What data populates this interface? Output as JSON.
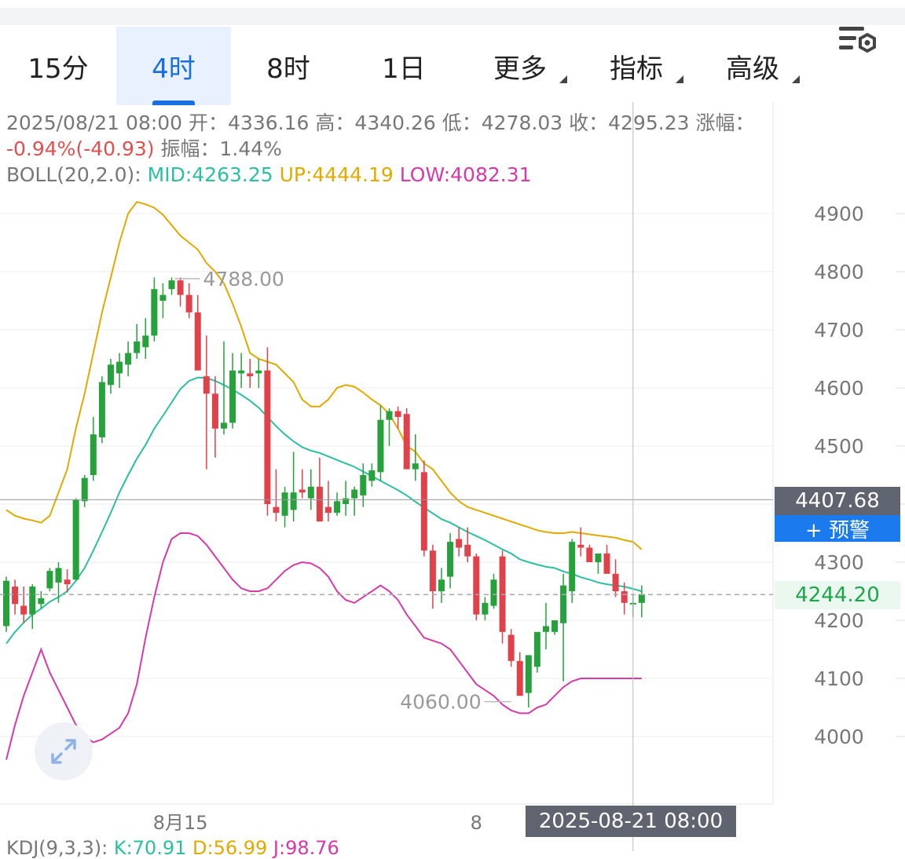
{
  "tabs": [
    {
      "label": "15分",
      "dropdown": false
    },
    {
      "label": "4时",
      "dropdown": false,
      "active": true
    },
    {
      "label": "8时",
      "dropdown": false
    },
    {
      "label": "1日",
      "dropdown": false
    },
    {
      "label": "更多",
      "dropdown": true
    },
    {
      "label": "指标",
      "dropdown": true
    },
    {
      "label": "高级",
      "dropdown": true
    }
  ],
  "info": {
    "datetime": "2025/08/21 08:00",
    "open_label": "开：",
    "open": "4336.16",
    "high_label": "高：",
    "high": "4340.26",
    "low_label": "低：",
    "low": "4278.03",
    "close_label": "收：",
    "close": "4295.23",
    "change_label": "涨幅：",
    "change": "-0.94%(-40.93)",
    "amplitude_label": "振幅：",
    "amplitude": "1.44%",
    "boll_label": "BOLL(20,2.0):",
    "boll_mid": "MID:4263.25",
    "boll_up": "UP:4444.19",
    "boll_low": "LOW:4082.31"
  },
  "crosshair_price": "4407.68",
  "alert_button": "+ 预警",
  "last_price": "4244.20",
  "crosshair_time": "2025-08-21 08:00",
  "kdj": {
    "label": "KDJ(9,3,3):",
    "k": "K:70.91",
    "d": "D:56.99",
    "j": "J:98.76"
  },
  "colors": {
    "up": "#26a13b",
    "down": "#e0424b",
    "mid": "#2bbfa0",
    "upper": "#e0aa00",
    "lower": "#d63aa8",
    "accent": "#1a6fe0"
  },
  "chart_data": {
    "type": "candlestick",
    "ylim": [
      3940,
      4960
    ],
    "y_ticks": [
      4000,
      4100,
      4200,
      4300,
      4400,
      4500,
      4600,
      4700,
      4800,
      4900
    ],
    "y_tick_labels": [
      "4000",
      "4100",
      "4200",
      "4300",
      "",
      "4500",
      "4600",
      "4700",
      "4800",
      "4900"
    ],
    "x_labels": [
      {
        "index": 20,
        "label": "8月15"
      },
      {
        "index": 54,
        "label": "8"
      }
    ],
    "annotations": [
      {
        "index": 19,
        "value": 4788.0,
        "label": "4788.00"
      },
      {
        "index": 58,
        "value": 4060.0,
        "label": "4060.00"
      }
    ],
    "candles": [
      [
        4190,
        4275,
        4180,
        4268
      ],
      [
        4258,
        4270,
        4210,
        4228
      ],
      [
        4225,
        4258,
        4195,
        4210
      ],
      [
        4210,
        4262,
        4185,
        4258
      ],
      [
        4228,
        4250,
        4220,
        4238
      ],
      [
        4255,
        4290,
        4250,
        4285
      ],
      [
        4265,
        4300,
        4230,
        4290
      ],
      [
        4270,
        4288,
        4248,
        4262
      ],
      [
        4270,
        4410,
        4268,
        4408
      ],
      [
        4405,
        4450,
        4395,
        4445
      ],
      [
        4450,
        4550,
        4440,
        4520
      ],
      [
        4515,
        4620,
        4505,
        4610
      ],
      [
        4605,
        4650,
        4590,
        4640
      ],
      [
        4625,
        4660,
        4600,
        4645
      ],
      [
        4640,
        4680,
        4620,
        4660
      ],
      [
        4660,
        4710,
        4650,
        4680
      ],
      [
        4670,
        4720,
        4650,
        4690
      ],
      [
        4690,
        4790,
        4680,
        4770
      ],
      [
        4750,
        4780,
        4720,
        4760
      ],
      [
        4770,
        4790,
        4760,
        4785
      ],
      [
        4785,
        4790,
        4740,
        4760
      ],
      [
        4760,
        4780,
        4720,
        4730
      ],
      [
        4730,
        4760,
        4640,
        4630
      ],
      [
        4620,
        4690,
        4460,
        4590
      ],
      [
        4590,
        4620,
        4480,
        4530
      ],
      [
        4530,
        4680,
        4520,
        4540
      ],
      [
        4540,
        4660,
        4530,
        4630
      ],
      [
        4625,
        4660,
        4600,
        4630
      ],
      [
        4625,
        4650,
        4600,
        4620
      ],
      [
        4625,
        4650,
        4600,
        4630
      ],
      [
        4630,
        4670,
        4380,
        4400
      ],
      [
        4395,
        4460,
        4370,
        4385
      ],
      [
        4380,
        4430,
        4360,
        4420
      ],
      [
        4390,
        4490,
        4370,
        4420
      ],
      [
        4425,
        4460,
        4410,
        4420
      ],
      [
        4410,
        4460,
        4390,
        4430
      ],
      [
        4430,
        4480,
        4370,
        4370
      ],
      [
        4395,
        4440,
        4370,
        4385
      ],
      [
        4385,
        4420,
        4380,
        4405
      ],
      [
        4400,
        4440,
        4380,
        4410
      ],
      [
        4410,
        4430,
        4380,
        4425
      ],
      [
        4415,
        4470,
        4395,
        4450
      ],
      [
        4440,
        4470,
        4430,
        4458
      ],
      [
        4455,
        4570,
        4440,
        4545
      ],
      [
        4545,
        4565,
        4500,
        4560
      ],
      [
        4560,
        4568,
        4530,
        4550
      ],
      [
        4555,
        4565,
        4470,
        4460
      ],
      [
        4460,
        4520,
        4440,
        4470
      ],
      [
        4455,
        4475,
        4310,
        4320
      ],
      [
        4320,
        4330,
        4220,
        4250
      ],
      [
        4250,
        4290,
        4230,
        4270
      ],
      [
        4275,
        4350,
        4255,
        4335
      ],
      [
        4340,
        4360,
        4310,
        4325
      ],
      [
        4330,
        4360,
        4300,
        4310
      ],
      [
        4310,
        4315,
        4200,
        4210
      ],
      [
        4210,
        4240,
        4200,
        4230
      ],
      [
        4225,
        4280,
        4220,
        4270
      ],
      [
        4310,
        4320,
        4160,
        4180
      ],
      [
        4175,
        4185,
        4120,
        4130
      ],
      [
        4130,
        4145,
        4080,
        4070
      ],
      [
        4075,
        4130,
        4050,
        4140
      ],
      [
        4120,
        4170,
        4110,
        4180
      ],
      [
        4180,
        4230,
        4150,
        4190
      ],
      [
        4180,
        4200,
        4175,
        4200
      ],
      [
        4195,
        4280,
        4095,
        4260
      ],
      [
        4250,
        4340,
        4230,
        4335
      ],
      [
        4330,
        4360,
        4310,
        4325
      ],
      [
        4325,
        4330,
        4300,
        4300
      ],
      [
        4300,
        4310,
        4280,
        4315
      ],
      [
        4315,
        4330,
        4300,
        4280
      ],
      [
        4280,
        4305,
        4240,
        4250
      ],
      [
        4250,
        4265,
        4210,
        4230
      ],
      [
        4230,
        4245,
        4205,
        4230
      ],
      [
        4230,
        4260,
        4205,
        4245
      ]
    ],
    "boll_mid": [
      4160,
      4180,
      4196,
      4210,
      4220,
      4232,
      4240,
      4250,
      4268,
      4290,
      4320,
      4352,
      4385,
      4420,
      4450,
      4478,
      4502,
      4530,
      4552,
      4575,
      4598,
      4612,
      4618,
      4617,
      4612,
      4605,
      4597,
      4588,
      4578,
      4566,
      4550,
      4534,
      4520,
      4508,
      4498,
      4492,
      4488,
      4482,
      4476,
      4470,
      4464,
      4456,
      4448,
      4440,
      4432,
      4424,
      4415,
      4404,
      4394,
      4384,
      4374,
      4368,
      4360,
      4352,
      4345,
      4338,
      4330,
      4322,
      4315,
      4305,
      4300,
      4296,
      4292,
      4290,
      4284,
      4280,
      4274,
      4270,
      4265,
      4262,
      4260,
      4258,
      4254,
      4250
    ],
    "boll_up": [
      4390,
      4380,
      4375,
      4372,
      4368,
      4380,
      4420,
      4460,
      4530,
      4590,
      4660,
      4730,
      4790,
      4850,
      4900,
      4920,
      4916,
      4910,
      4898,
      4880,
      4862,
      4850,
      4838,
      4815,
      4800,
      4780,
      4745,
      4705,
      4660,
      4650,
      4645,
      4640,
      4625,
      4610,
      4580,
      4568,
      4568,
      4580,
      4600,
      4605,
      4602,
      4592,
      4580,
      4570,
      4555,
      4530,
      4500,
      4490,
      4470,
      4460,
      4440,
      4420,
      4405,
      4395,
      4390,
      4385,
      4380,
      4375,
      4370,
      4365,
      4360,
      4355,
      4352,
      4350,
      4350,
      4352,
      4350,
      4348,
      4346,
      4344,
      4342,
      4338,
      4335,
      4322
    ],
    "boll_low": [
      3960,
      4020,
      4070,
      4110,
      4150,
      4110,
      4080,
      4050,
      4020,
      4000,
      3990,
      3995,
      4005,
      4015,
      4040,
      4090,
      4170,
      4240,
      4300,
      4340,
      4350,
      4350,
      4345,
      4330,
      4310,
      4290,
      4270,
      4255,
      4250,
      4250,
      4255,
      4270,
      4285,
      4295,
      4300,
      4298,
      4290,
      4275,
      4250,
      4235,
      4230,
      4240,
      4250,
      4260,
      4250,
      4235,
      4210,
      4190,
      4170,
      4165,
      4160,
      4150,
      4130,
      4110,
      4090,
      4080,
      4070,
      4055,
      4045,
      4040,
      4040,
      4050,
      4055,
      4070,
      4085,
      4095,
      4100,
      4100,
      4100,
      4100,
      4100,
      4100,
      4100,
      4100
    ]
  }
}
